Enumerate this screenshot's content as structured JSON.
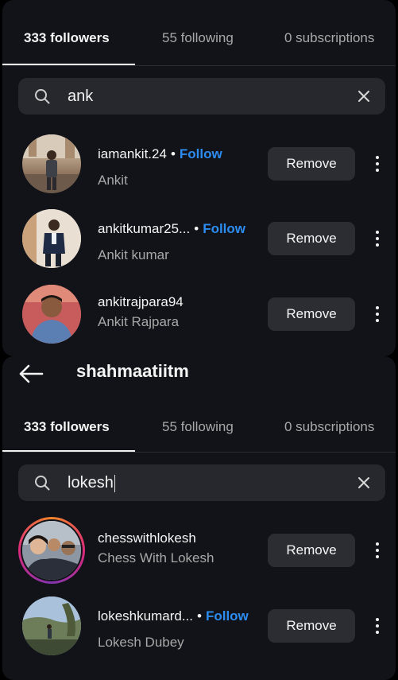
{
  "panel1": {
    "tabs": [
      {
        "label": "333 followers",
        "active": true
      },
      {
        "label": "55 following",
        "active": false
      },
      {
        "label": "0 subscriptions",
        "active": false
      }
    ],
    "search": {
      "value": "ank"
    },
    "rows": [
      {
        "username": "iamankit.24",
        "follow": "Follow",
        "fullname": "Ankit",
        "remove": "Remove"
      },
      {
        "username": "ankitkumar25...",
        "follow": "Follow",
        "fullname": "Ankit kumar",
        "remove": "Remove"
      },
      {
        "username": "ankitrajpara94",
        "follow": "",
        "fullname": "Ankit Rajpara",
        "remove": "Remove"
      }
    ]
  },
  "panel2": {
    "header": {
      "title": "shahmaatiitm"
    },
    "tabs": [
      {
        "label": "333 followers",
        "active": true
      },
      {
        "label": "55 following",
        "active": false
      },
      {
        "label": "0 subscriptions",
        "active": false
      }
    ],
    "search": {
      "value": "lokesh"
    },
    "rows": [
      {
        "username": "chesswithlokesh",
        "follow": "",
        "fullname": "Chess With Lokesh",
        "remove": "Remove"
      },
      {
        "username": "lokeshkumard...",
        "follow": "Follow",
        "fullname": "Lokesh Dubey",
        "remove": "Remove"
      }
    ]
  },
  "icons": {
    "search": "search-icon",
    "clear": "close-icon",
    "more": "more-vertical-icon",
    "back": "back-arrow-icon"
  },
  "colors": {
    "background": "#111318",
    "follow_link": "#2d8cf0",
    "button": "#2b2d32",
    "search_bg": "#26282d"
  }
}
